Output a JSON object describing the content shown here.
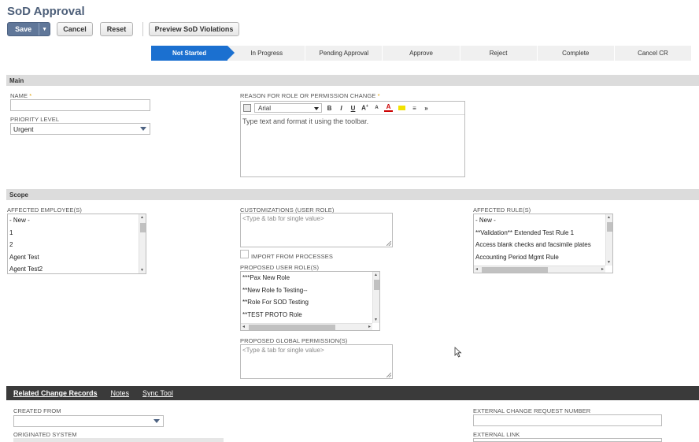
{
  "page": {
    "title": "SoD Approval"
  },
  "toolbar": {
    "save_label": "Save",
    "save_arrow": "▼",
    "cancel_label": "Cancel",
    "reset_label": "Reset",
    "preview_label": "Preview SoD Violations"
  },
  "status_steps": [
    {
      "label": "Not Started",
      "active": true
    },
    {
      "label": "In Progress",
      "active": false
    },
    {
      "label": "Pending Approval",
      "active": false
    },
    {
      "label": "Approve",
      "active": false
    },
    {
      "label": "Reject",
      "active": false
    },
    {
      "label": "Complete",
      "active": false
    },
    {
      "label": "Cancel CR",
      "active": false
    }
  ],
  "main_section": {
    "heading": "Main",
    "name_label": "NAME",
    "required_mark": "*",
    "name_value": "",
    "priority_label": "PRIORITY LEVEL",
    "priority_value": "Urgent",
    "reason_label": "REASON FOR ROLE OR PERMISSION CHANGE",
    "reason_placeholder": "Type text and format it using the toolbar.",
    "font_value": "Arial",
    "rte_buttons": [
      "B",
      "I",
      "U",
      "A",
      "A",
      "A",
      "»"
    ]
  },
  "scope_section": {
    "heading": "Scope",
    "employees_label": "AFFECTED EMPLOYEE(S)",
    "employees": [
      "- New -",
      "1",
      "2",
      "Agent Test",
      "Agent Test2"
    ],
    "customizations_label": "CUSTOMIZATIONS (USER ROLE)",
    "customizations_placeholder": "<Type & tab for single value>",
    "import_label": "IMPORT FROM PROCESSES",
    "proposed_roles_label": "PROPOSED USER ROLE(S)",
    "proposed_roles": [
      "***Pax New Role",
      "**New Role fo Testing--",
      "**Role For SOD Testing",
      "**TEST PROTO Role"
    ],
    "global_perm_label": "PROPOSED GLOBAL PERMISSION(S)",
    "global_perm_placeholder": "<Type & tab for single value>",
    "rules_label": "AFFECTED RULE(S)",
    "rules": [
      "- New -",
      "**Validation** Extended Test Rule 1",
      "Access blank checks and facsimile plates",
      "Accounting Period Mgmt Rule"
    ]
  },
  "subtabs": {
    "items": [
      "Related Change Records",
      "Notes",
      "Sync Tool"
    ]
  },
  "related": {
    "created_from_label": "CREATED FROM",
    "originated_label": "ORIGINATED SYSTEM",
    "ext_cr_label": "EXTERNAL CHANGE REQUEST NUMBER",
    "ext_link_label": "EXTERNAL LINK"
  },
  "colors": {
    "accent": "#1b70d0",
    "save_button": "#607799",
    "title": "#4d5f79",
    "tab_bar": "#3a3a3a",
    "required": "#e0a000"
  }
}
